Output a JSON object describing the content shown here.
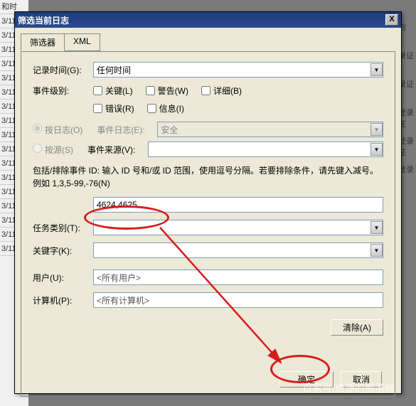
{
  "dialog": {
    "title": "筛选当前日志",
    "close": "X"
  },
  "tabs": {
    "filter": "筛选器",
    "xml": "XML"
  },
  "recordTime": {
    "label": "记录时间(G):",
    "value": "任何时间"
  },
  "eventLevel": {
    "label": "事件级别:",
    "critical": "关键(L)",
    "warning": "警告(W)",
    "verbose": "详细(B)",
    "error": "错误(R)",
    "info": "信息(I)"
  },
  "radio": {
    "byLog": "按日志(O)",
    "bySource": "按源(S)"
  },
  "eventLog": {
    "label": "事件日志(E):",
    "value": "安全"
  },
  "eventSource": {
    "label": "事件来源(V):",
    "value": ""
  },
  "instruction": "包括/排除事件 ID: 输入 ID 号和/或 ID 范围，使用逗号分隔。若要排除条件，请先键入减号。例如 1,3,5-99,-76(N)",
  "eventId": {
    "value": "4624,4625"
  },
  "taskCat": {
    "label": "任务类别(T):",
    "value": ""
  },
  "keywords": {
    "label": "关键字(K):",
    "value": ""
  },
  "user": {
    "label": "用户(U):",
    "value": "<所有用户>"
  },
  "computer": {
    "label": "计算机(P):",
    "value": "<所有计算机>"
  },
  "buttons": {
    "clear": "清除(A)",
    "ok": "确定",
    "cancel": "取消"
  },
  "bg": {
    "date": "3/11,",
    "header": "和时",
    "r1": "别",
    "r2": "录证",
    "r3": "登录证",
    "r4": "登录"
  },
  "watermark": "百家号/启源的部落格"
}
